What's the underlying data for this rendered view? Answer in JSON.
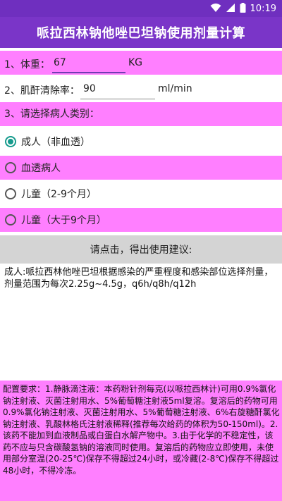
{
  "status_bar": {
    "time": "10:19",
    "icons": [
      "wifi-icon",
      "signal-icon",
      "battery-icon"
    ]
  },
  "app": {
    "title": "哌拉西林钠他唑巴坦钠使用剂量计算"
  },
  "form": {
    "weight": {
      "label": "1、体重：",
      "value": "67",
      "unit": "KG"
    },
    "creatinine": {
      "label": "2、肌酐清除率：",
      "value": "90",
      "unit": "ml/min"
    },
    "patient_type_prompt": "3、请选择病人类别：",
    "patient_types": [
      {
        "label": "成人（非血透）",
        "checked": true
      },
      {
        "label": "血透病人",
        "checked": false
      },
      {
        "label": "儿童（2-9个月）",
        "checked": false
      },
      {
        "label": "儿童（大于9个月）",
        "checked": false
      }
    ]
  },
  "calc_button_label": "请点击，得出使用建议:",
  "result": {
    "text": "成人:哌拉西林他唑巴坦根据感染的严重程度和感染部位选择剂量，剂量范围为每次2.25g~4.5g，q6h/q8h/q12h"
  },
  "config": {
    "text": "配置要求：1.静脉滴注液：本药粉针剂每克(以哌拉西林计)可用0.9%氯化钠注射液、灭菌注射用水、5%葡萄糖注射液5ml复溶。复溶后的药物可用0.9%氯化钠注射液、灭菌注射用水、5%葡萄糖注射液、6%右旋糖酐氯化钠注射液、乳酸林格氏注射液稀释(推荐每次给药的体积为50-150ml)。2.该药不能加到血液制品或白蛋白水解产物中。3.由于化学的不稳定性，该药不应与只含碳酸氢钠的溶液同时使用。复溶后的药物应立即使用，未使用部分室温(20-25℃)保存不得超过24小时，或冷藏(2-8℃)保存不得超过48小时，不得冷冻。"
  },
  "colors": {
    "app_bar": "#7a35c8",
    "status_bar": "#6f2fbf",
    "pink_row": "#ff7fff",
    "radio_checked": "#149a8c",
    "button_bg": "#d4d4d4"
  }
}
